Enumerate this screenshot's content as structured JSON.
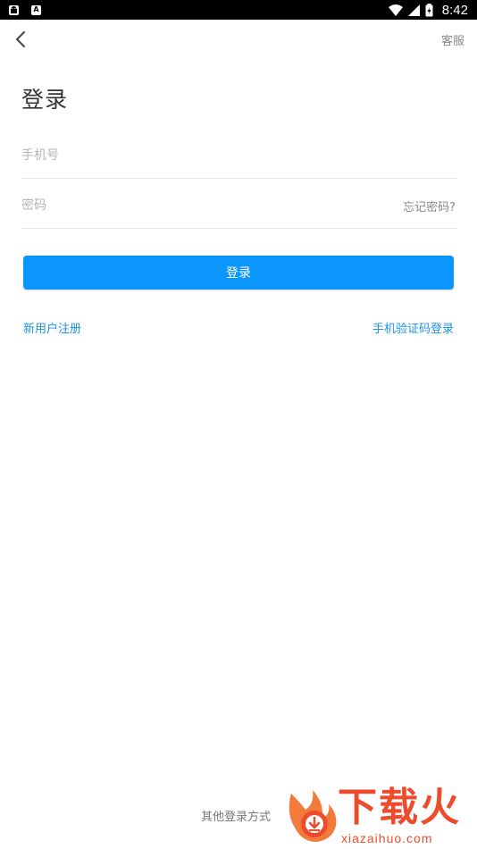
{
  "status_bar": {
    "time": "8:42",
    "left_icons": [
      "android-icon",
      "a-icon"
    ],
    "right_icons": [
      "wifi-icon",
      "signal-icon",
      "battery-icon"
    ]
  },
  "header": {
    "back_icon": "chevron-left-icon",
    "service_label": "客服"
  },
  "page_title": "登录",
  "form": {
    "phone_placeholder": "手机号",
    "password_placeholder": "密码",
    "forgot_label": "忘记密码?",
    "login_button": "登录"
  },
  "links": {
    "register": "新用户注册",
    "sms_login": "手机验证码登录"
  },
  "footer": {
    "other_login": "其他登录方式"
  },
  "watermark": {
    "title": "下载火",
    "url": "xiazaihuo.com"
  },
  "colors": {
    "primary": "#0a96fa",
    "link": "#1a93e8",
    "watermark": "#ec4b2c"
  }
}
